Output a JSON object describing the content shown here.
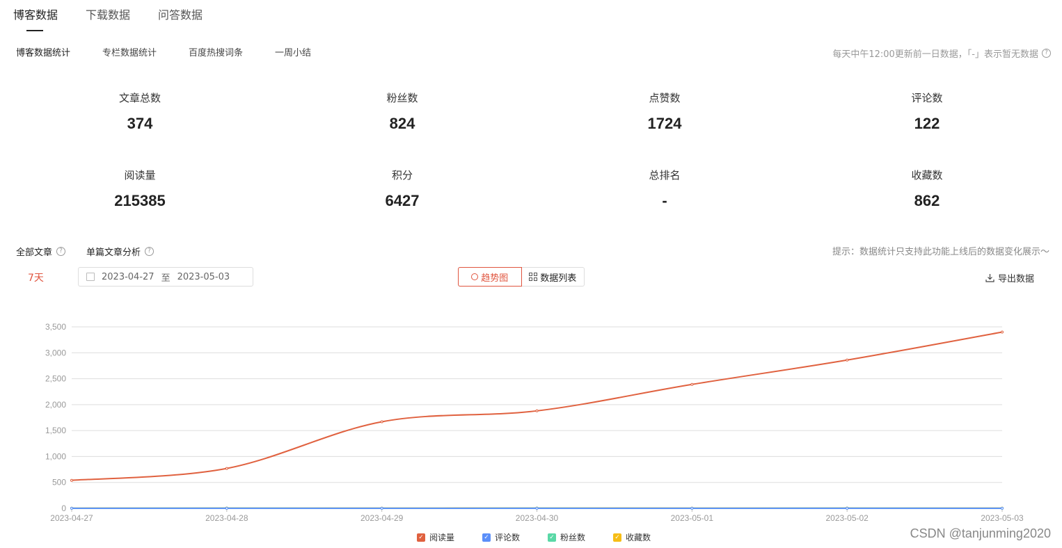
{
  "tabs": [
    "博客数据",
    "下载数据",
    "问答数据"
  ],
  "subtabs": [
    "博客数据统计",
    "专栏数据统计",
    "百度热搜词条",
    "一周小结"
  ],
  "update_note": "每天中午12:00更新前一日数据，「-」表示暂无数据",
  "stats": [
    {
      "label": "文章总数",
      "value": "374"
    },
    {
      "label": "粉丝数",
      "value": "824"
    },
    {
      "label": "点赞数",
      "value": "1724"
    },
    {
      "label": "评论数",
      "value": "122"
    },
    {
      "label": "阅读量",
      "value": "215385"
    },
    {
      "label": "积分",
      "value": "6427"
    },
    {
      "label": "总排名",
      "value": "-"
    },
    {
      "label": "收藏数",
      "value": "862"
    }
  ],
  "filters": {
    "all_articles": "全部文章",
    "single_article": "单篇文章分析",
    "hint": "提示：数据统计只支持此功能上线后的数据变化展示～",
    "range_label": "7天",
    "start_date": "2023-04-27",
    "date_sep": "至",
    "end_date": "2023-05-03",
    "trend_label": "趋势图",
    "list_label": "数据列表",
    "export_label": "导出数据"
  },
  "watermark": "CSDN @tanjunming2020",
  "colors": {
    "accent": "#e0543e",
    "read": "#e0613f",
    "comment": "#5b8ff9",
    "fans": "#5ad8a6",
    "favorite": "#f6bd16"
  },
  "chart_data": {
    "type": "line",
    "x": [
      "2023-04-27",
      "2023-04-28",
      "2023-04-29",
      "2023-04-30",
      "2023-05-01",
      "2023-05-02",
      "2023-05-03"
    ],
    "ylim": [
      0,
      3500
    ],
    "yticks": [
      0,
      500,
      1000,
      1500,
      2000,
      2500,
      3000,
      3500
    ],
    "ytick_labels": [
      "0",
      "500",
      "1,000",
      "1,500",
      "2,000",
      "2,500",
      "3,000",
      "3,500"
    ],
    "grid": true,
    "legend_position": "bottom",
    "series": [
      {
        "name": "阅读量",
        "color": "#e0613f",
        "values": [
          540,
          770,
          1670,
          1880,
          2390,
          2860,
          3400
        ]
      },
      {
        "name": "评论数",
        "color": "#5b8ff9",
        "values": [
          1,
          2,
          1,
          2,
          1,
          2,
          1
        ]
      },
      {
        "name": "粉丝数",
        "color": "#5ad8a6",
        "values": [
          2,
          3,
          2,
          3,
          2,
          3,
          2
        ]
      },
      {
        "name": "收藏数",
        "color": "#f6bd16",
        "values": [
          4,
          6,
          5,
          7,
          5,
          6,
          5
        ]
      }
    ]
  }
}
